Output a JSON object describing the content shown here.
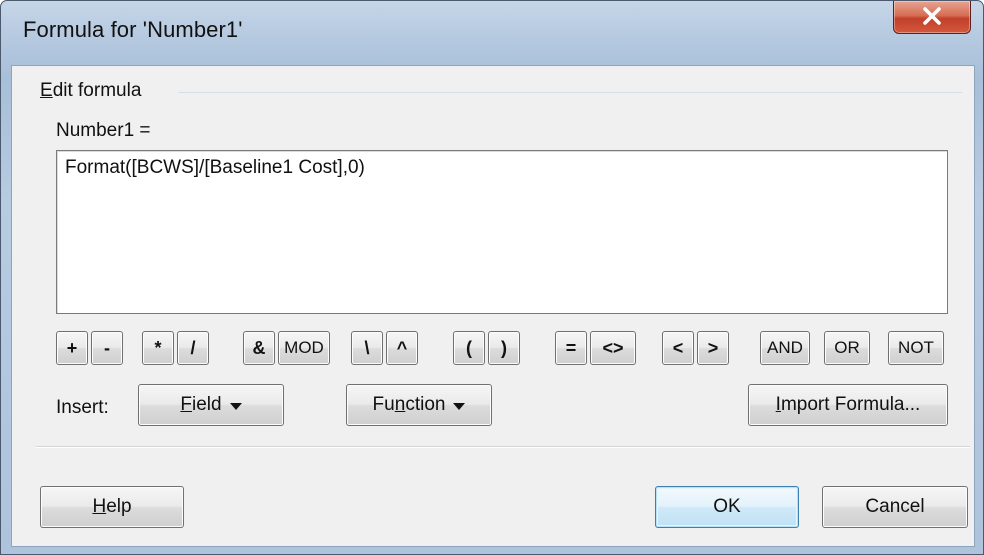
{
  "window": {
    "title": "Formula for 'Number1'"
  },
  "group": {
    "label": "Edit formula"
  },
  "field": {
    "label": "Number1 ="
  },
  "formula": {
    "value": "Format([BCWS]/[Baseline1 Cost],0)"
  },
  "operators": [
    "+",
    "-",
    "*",
    "/",
    "&",
    "MOD",
    "\\",
    "^",
    "(",
    ")",
    "=",
    "<>",
    "<",
    ">",
    "AND",
    "OR",
    "NOT"
  ],
  "insert": {
    "label": "Insert:",
    "field_button": "Field",
    "function_button": "Function",
    "import_button": "Import Formula..."
  },
  "buttons": {
    "help": "Help",
    "ok": "OK",
    "cancel": "Cancel"
  }
}
